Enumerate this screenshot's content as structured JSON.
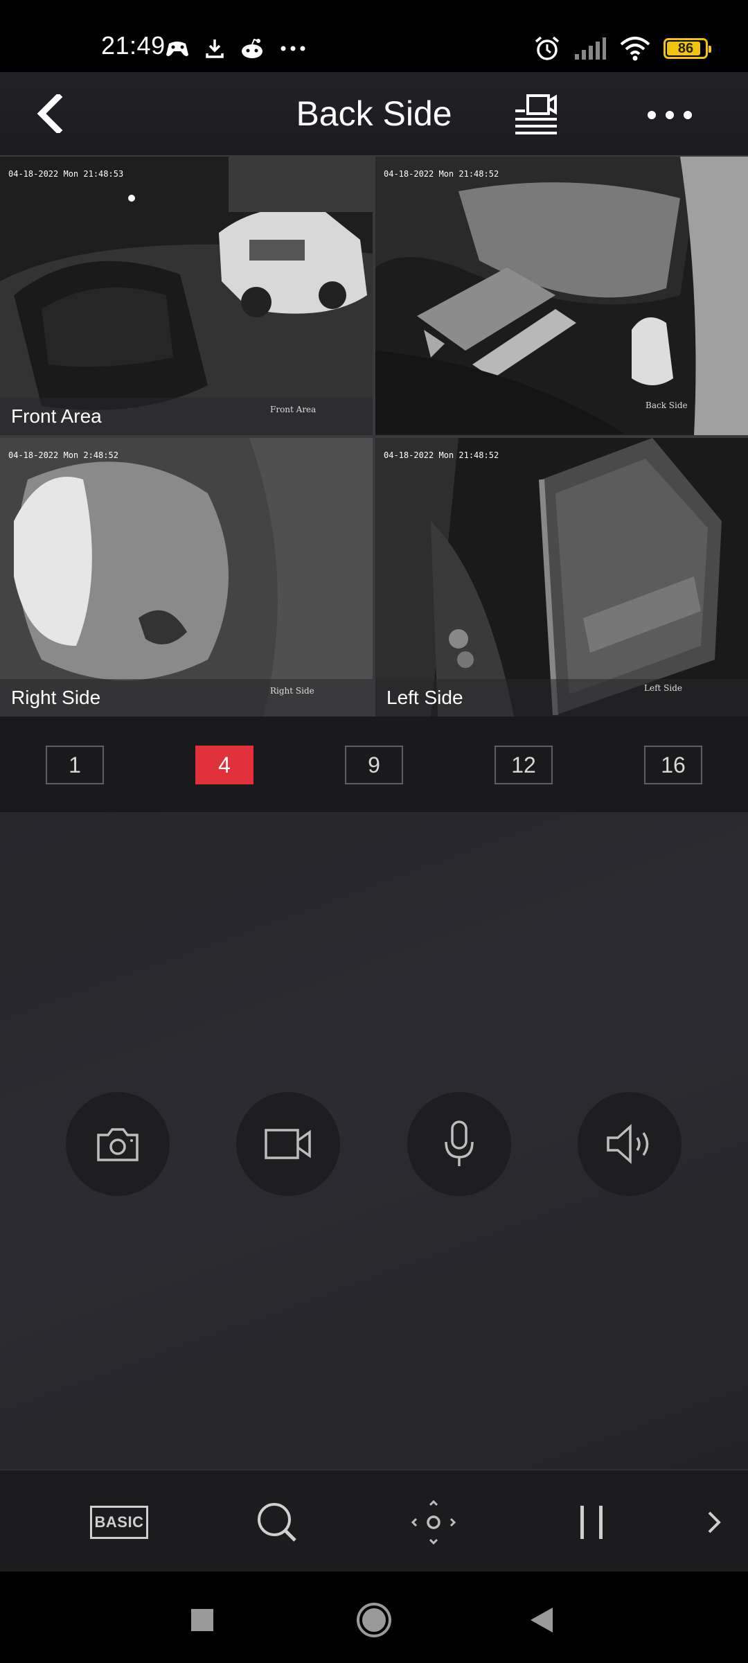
{
  "status_bar": {
    "time": "21:49",
    "battery_level": "86",
    "left_icons": [
      "game-controller-icon",
      "download-icon",
      "reddit-icon",
      "more-dots-icon"
    ],
    "right_icons": [
      "alarm-icon",
      "signal-icon",
      "wifi-icon",
      "battery-icon"
    ]
  },
  "header": {
    "title": "Back Side",
    "icons": [
      "back-arrow-icon",
      "live-view-list-icon",
      "more-icon"
    ]
  },
  "grid": {
    "cameras": [
      {
        "label": "Front Area",
        "osd_time": "04-18-2022 Mon 21:48:53",
        "osd_name": "Front Area",
        "selected": false
      },
      {
        "label": "",
        "osd_time": "04-18-2022 Mon 21:48:52",
        "osd_name": "Back Side",
        "selected": true
      },
      {
        "label": "Right Side",
        "osd_time": "04-18-2022 Mon 2:48:52",
        "osd_name": "Right Side",
        "selected": false
      },
      {
        "label": "Left Side",
        "osd_time": "04-18-2022 Mon 21:48:52",
        "osd_name": "Left Side",
        "selected": false
      }
    ]
  },
  "split_options": [
    "1",
    "4",
    "9",
    "12",
    "16"
  ],
  "split_selected": "4",
  "controls": [
    "camera-snapshot-icon",
    "video-record-icon",
    "microphone-icon",
    "speaker-icon"
  ],
  "toolbar": {
    "basic_label": "BASIC",
    "icons": [
      "search-icon",
      "ptz-direction-icon",
      "pause-icon",
      "chevron-right-icon"
    ]
  },
  "navbar": {
    "icons": [
      "recents-square-icon",
      "home-circle-icon",
      "back-triangle-icon"
    ]
  },
  "colors": {
    "accent": "#e0303a",
    "background": "#26262b",
    "toolbar": "#1c1c1f"
  }
}
